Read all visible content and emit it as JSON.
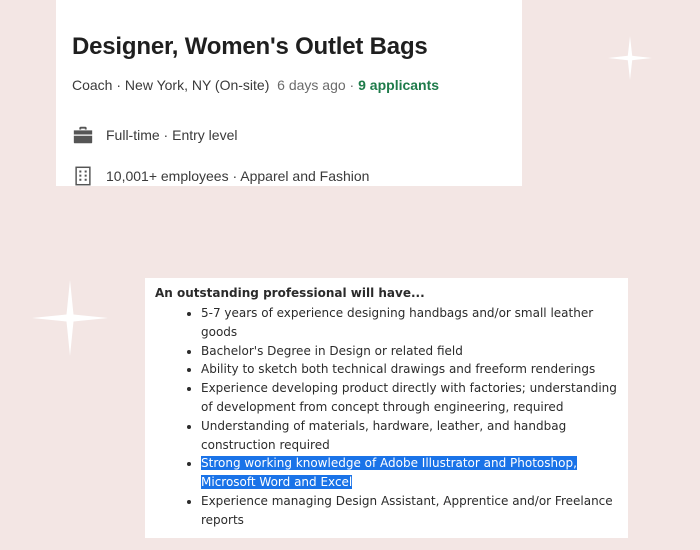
{
  "job": {
    "title": "Designer, Women's Outlet Bags",
    "company": "Coach",
    "location": "New York, NY (On-site)",
    "posted": "6 days ago",
    "applicants": "9 applicants",
    "separator": " · ",
    "employment": "Full-time · Entry level",
    "company_info": "10,001+ employees · Apparel and Fashion",
    "icons": {
      "employment": "briefcase-icon",
      "company": "building-icon"
    },
    "colors": {
      "applicants": "#1e7b4a"
    }
  },
  "requirements": {
    "heading": "An outstanding professional will have...",
    "items": [
      "5-7 years of experience designing handbags and/or small leather goods",
      "Bachelor's Degree in Design or related field",
      "Ability to sketch both technical drawings and freeform renderings",
      "Experience developing product directly with factories; understanding of development from concept through engineering, required",
      "Understanding of materials, hardware, leather, and handbag construction required",
      "Strong working knowledge of Adobe Illustrator and Photoshop, Microsoft Word and Excel",
      "Experience managing Design Assistant, Apprentice and/or Freelance reports"
    ],
    "highlighted_index": 5,
    "colors": {
      "highlight": "#1a73e8"
    }
  },
  "decor": {
    "background": "#f3e6e4",
    "sparkle_icon": "sparkle-icon"
  }
}
